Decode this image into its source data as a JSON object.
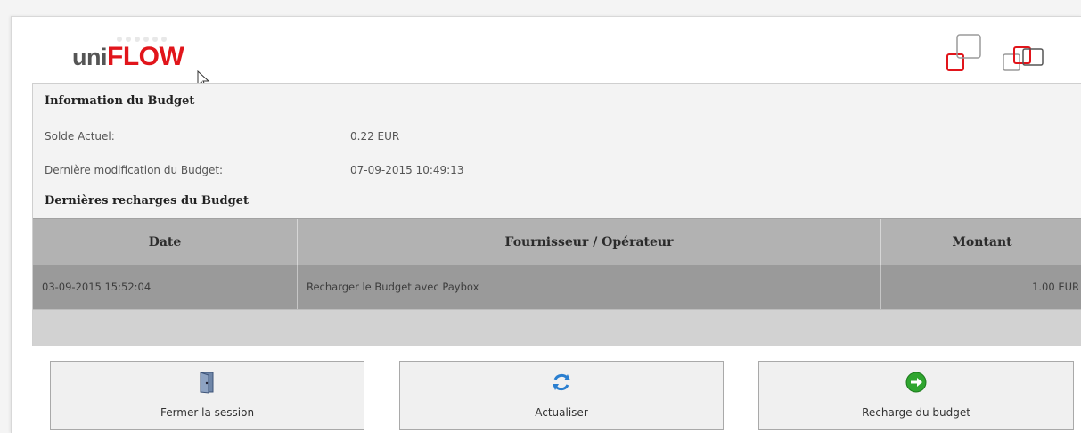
{
  "logo": {
    "prefix": "uni",
    "brand": "FLOW"
  },
  "colors": {
    "brand_red": "#e1151b",
    "header_gray": "#b2b2b2",
    "row_gray": "#9a9a9a"
  },
  "budget": {
    "section_title": "Information du Budget",
    "balance_label": "Solde Actuel:",
    "balance_value": "0.22 EUR",
    "last_modified_label": "Dernière modification du Budget:",
    "last_modified_value": "07-09-2015 10:49:13",
    "recharges_title": "Dernières recharges du Budget"
  },
  "table": {
    "headers": [
      "Date",
      "Fournisseur / Opérateur",
      "Montant"
    ],
    "rows": [
      [
        "03-09-2015 15:52:04",
        "Recharger le Budget avec Paybox",
        "1.00 EUR"
      ]
    ]
  },
  "buttons": {
    "logout": {
      "label": "Fermer la session",
      "icon": "door-exit-icon"
    },
    "refresh": {
      "label": "Actualiser",
      "icon": "refresh-arrows-icon"
    },
    "recharge": {
      "label": "Recharge du budget",
      "icon": "green-arrow-circle-icon"
    }
  }
}
